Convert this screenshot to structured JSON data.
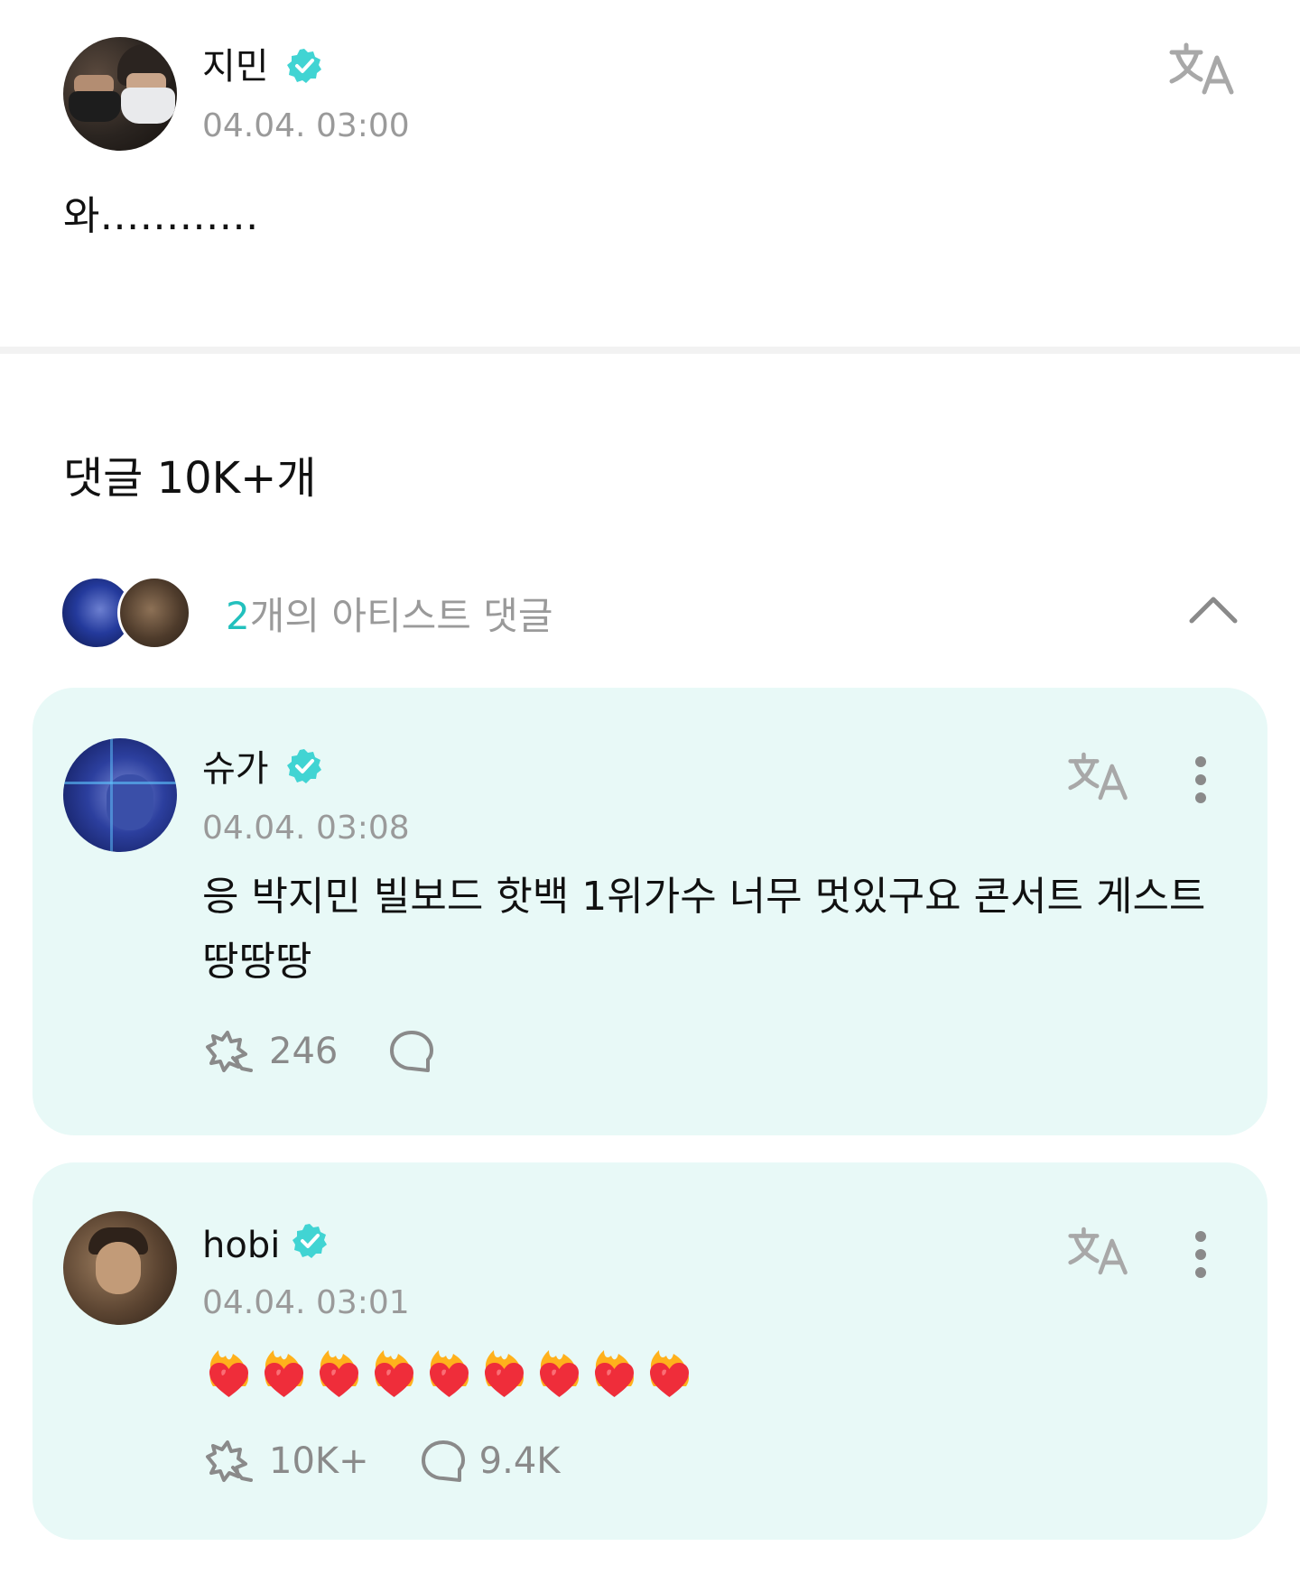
{
  "post": {
    "author": "지민",
    "timestamp": "04.04. 03:00",
    "body": "와…………"
  },
  "comments_header": {
    "count_label": "댓글 10K+개"
  },
  "artist_comments": {
    "count_number": "2",
    "count_suffix": "개의 아티스트 댓글"
  },
  "comments": [
    {
      "author": "슈가",
      "timestamp": "04.04. 03:08",
      "text": "응 박지민 빌보드 핫백 1위가수 너무 멋있구요 콘서트 게스트 땅땅땅",
      "likes": "246",
      "replies": ""
    },
    {
      "author": "hobi",
      "timestamp": "04.04. 03:01",
      "emoji_count": 9,
      "emoji": "heart-on-fire",
      "likes": "10K+",
      "replies": "9.4K"
    }
  ],
  "icons": {
    "translate": "translate-icon",
    "verified": "verified-badge-icon",
    "chevron": "chevron-up-icon",
    "more": "more-vertical-icon",
    "like": "weverse-like-icon",
    "reply": "comment-bubble-icon"
  },
  "colors": {
    "accent": "#22c0bd",
    "verified": "#41d4d3",
    "card_bg": "#e8f9f7",
    "muted_text": "#9a9a9a"
  }
}
